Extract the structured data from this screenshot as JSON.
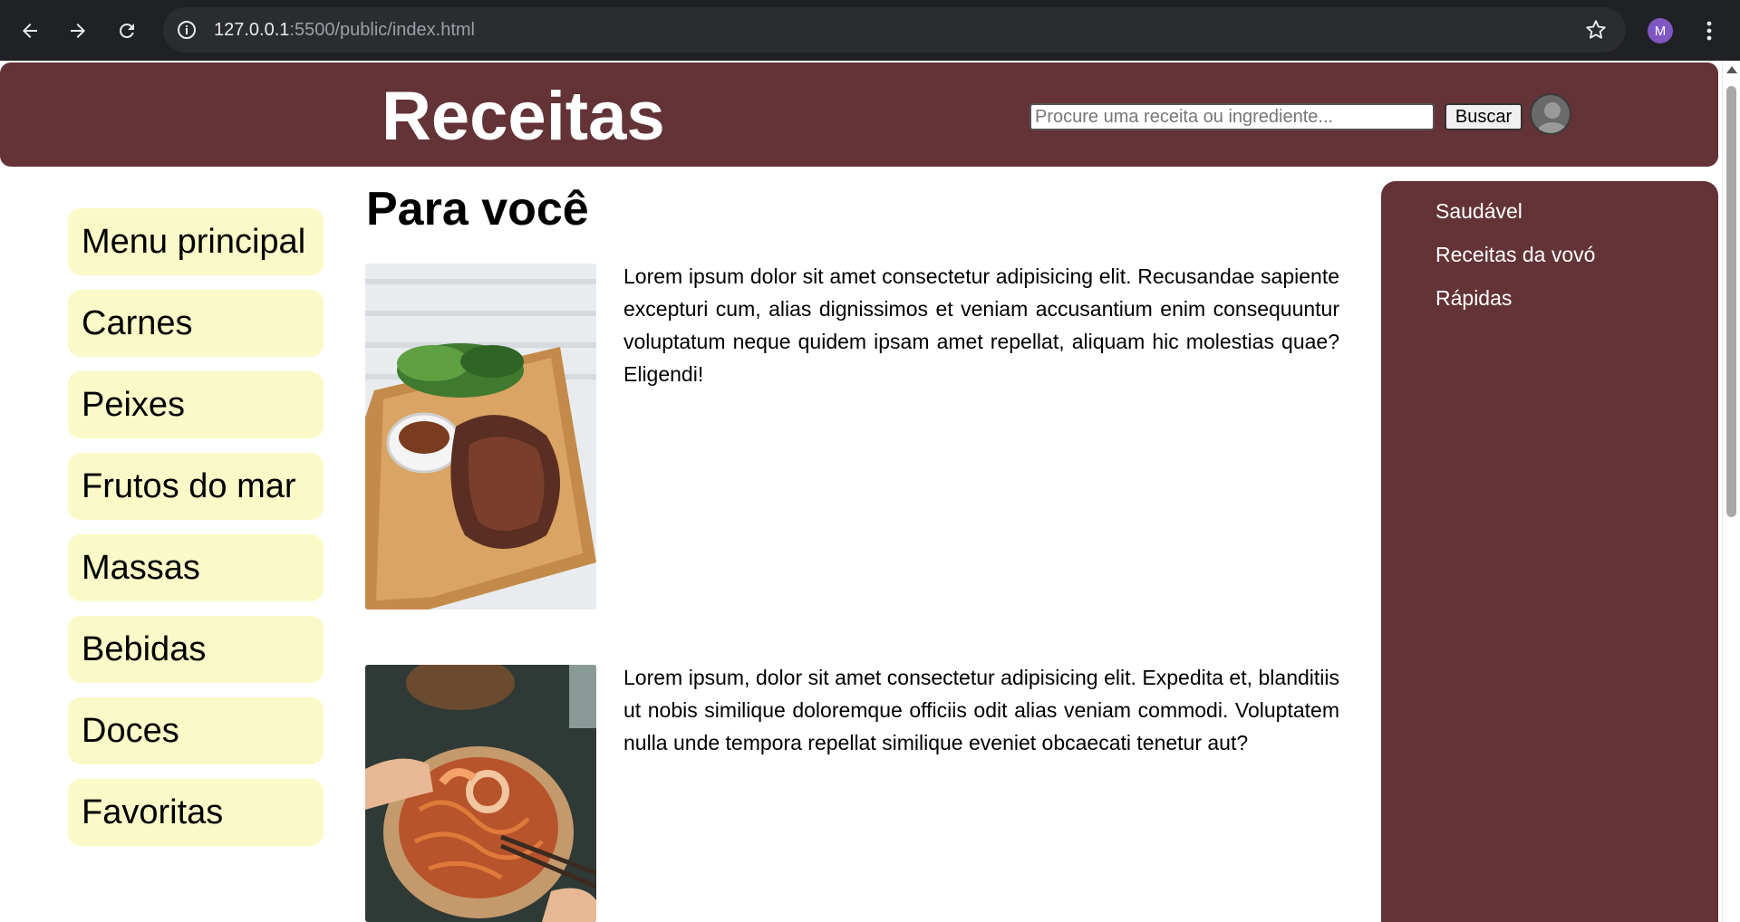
{
  "browser": {
    "url_host": "127.0.0.1",
    "url_rest": ":5500/public/index.html",
    "profile_initial": "M"
  },
  "header": {
    "title": "Receitas",
    "search_placeholder": "Procure uma receita ou ingrediente...",
    "search_button": "Buscar"
  },
  "left_menu": [
    "Menu principal",
    "Carnes",
    "Peixes",
    "Frutos do mar",
    "Massas",
    "Bebidas",
    "Doces",
    "Favoritas"
  ],
  "main": {
    "title": "Para você",
    "recipes": [
      {
        "image": "steak-on-board-icon",
        "text": "Lorem ipsum dolor sit amet consectetur adipisicing elit. Recusandae sapiente excepturi cum, alias dignissimos et veniam accusantium enim consequuntur voluptatum neque quidem ipsam amet repellat, aliquam hic molestias quae? Eligendi!"
      },
      {
        "image": "seafood-noodle-bowl-icon",
        "text": "Lorem ipsum, dolor sit amet consectetur adipisicing elit. Expedita et, blanditiis ut nobis similique doloremque officiis odit alias veniam commodi. Voluptatem nulla unde tempora repellat similique eveniet obcaecati tenetur aut?"
      }
    ]
  },
  "right_sidebar": [
    "Saudável",
    "Receitas da vovó",
    "Rápidas"
  ],
  "colors": {
    "brand": "#633337",
    "menu_item_bg": "#fafac8"
  }
}
